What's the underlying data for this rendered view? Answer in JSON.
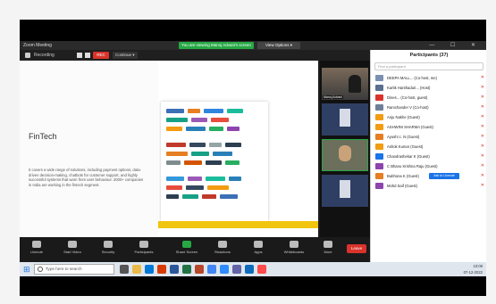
{
  "window": {
    "title": "Zoom Meeting"
  },
  "banner": {
    "share_text": "You are viewing Manoj Advani's screen",
    "view_options": "View Options ▾"
  },
  "toolbar_top": {
    "left_text": "Recording",
    "rec": "REC",
    "rec_status": "Continue ▾"
  },
  "slide": {
    "title": "FinTech",
    "body": "It covers a wide range of solutions, including payment options, data-driven decision-making, chatbots for customer support, and highly successful systems that warn from user behaviour. 2000+ companies in India are working in the fintech segment."
  },
  "thumbs": [
    {
      "name": "Manoj Advani"
    },
    {
      "name": ""
    },
    {
      "name": ""
    },
    {
      "name": ""
    }
  ],
  "bottom_toolbar": {
    "items": [
      {
        "label": "Unmute"
      },
      {
        "label": "Start Video"
      },
      {
        "label": "Security"
      },
      {
        "label": "Participants"
      },
      {
        "label": "Share Screen"
      },
      {
        "label": "Reactions"
      },
      {
        "label": "Apps"
      },
      {
        "label": "Whiteboards"
      },
      {
        "label": "More"
      }
    ],
    "end": "Leave"
  },
  "participants": {
    "header": "Participants (37)",
    "search_placeholder": "Find a participant",
    "rows": [
      {
        "name": "DEEPA MALL... (Co-host, me)",
        "color": "#7b8fb0"
      },
      {
        "name": "Kartik Hanthaduri... (Host)",
        "color": "#5b6f8f"
      },
      {
        "name": "Dines... (Co-host, guest)",
        "color": "#d9332b"
      },
      {
        "name": "Ramchander V (Co-host)",
        "color": "#6e7f99"
      },
      {
        "name": "Anju Nakhe (Guest)",
        "color": "#f39c12"
      },
      {
        "name": "ASHWINI SHARMA (Guest)",
        "color": "#f39c12"
      },
      {
        "name": "Ayushi c. N (Guest)",
        "color": "#e67e22"
      },
      {
        "name": "Ashok Kumar (Guest)",
        "color": "#f39c12"
      },
      {
        "name": "Chandrashekar K (Guest)",
        "color": "#1a73e8"
      },
      {
        "name": "C Bhanu Krishna Raju (Guest)",
        "color": "#8e44ad"
      },
      {
        "name": "Bubhona K (Guest)",
        "color": "#e67e22"
      },
      {
        "name": "Mohd Saif (Guest)",
        "color": "#8e44ad"
      }
    ],
    "ask_unmute": "Ask to Unmute",
    "footer": {
      "invite": "Invite",
      "mute_all": "Mute All",
      "more": "..."
    }
  },
  "taskbar": {
    "search_placeholder": "Type here to search",
    "tray_time": "10:08",
    "tray_date": "07-12-2022"
  }
}
